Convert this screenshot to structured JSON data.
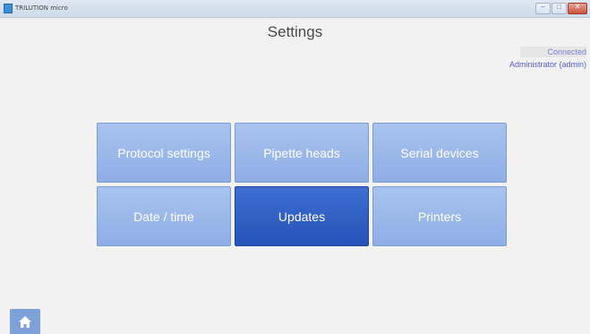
{
  "window": {
    "title": "TRILUTION micro",
    "minimize_icon": "minimize-icon",
    "maximize_icon": "maximize-icon",
    "close_icon": "close-icon"
  },
  "page": {
    "title": "Settings"
  },
  "status": {
    "connection": "Connected",
    "user": "Administrator (admin)"
  },
  "tiles": [
    {
      "label": "Protocol settings",
      "selected": false
    },
    {
      "label": "Pipette heads",
      "selected": false
    },
    {
      "label": "Serial devices",
      "selected": false
    },
    {
      "label": "Date / time",
      "selected": false
    },
    {
      "label": "Updates",
      "selected": true
    },
    {
      "label": "Printers",
      "selected": false
    }
  ],
  "footer": {
    "home_icon": "home-icon"
  },
  "colors": {
    "tile": "#9bb7ea",
    "tile_selected": "#2e5ec4",
    "status_text": "#5a5ad0"
  }
}
